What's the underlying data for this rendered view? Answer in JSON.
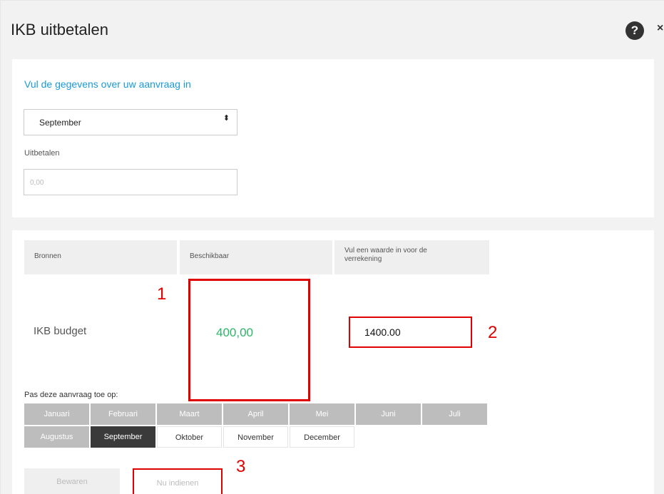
{
  "modal": {
    "title": "IKB uitbetalen",
    "help_icon": "?",
    "close_icon": "×"
  },
  "form": {
    "heading": "Vul de gegevens over uw aanvraag in",
    "month_select": {
      "value": "September",
      "arrows": "⬍"
    },
    "payout_label": "Uitbetalen",
    "payout_placeholder": "0,00"
  },
  "sources_table": {
    "headers": [
      "Bronnen",
      "Beschikbaar",
      "Vul een waarde in voor de verrekening"
    ],
    "row": {
      "label": "IKB budget",
      "available": "400,00",
      "settlement_value": "1400.00"
    }
  },
  "apply": {
    "label": "Pas deze aanvraag toe op:",
    "months": [
      {
        "name": "Januari",
        "state": "disabled"
      },
      {
        "name": "Februari",
        "state": "disabled"
      },
      {
        "name": "Maart",
        "state": "disabled"
      },
      {
        "name": "April",
        "state": "disabled"
      },
      {
        "name": "Mei",
        "state": "disabled"
      },
      {
        "name": "Juni",
        "state": "disabled"
      },
      {
        "name": "Juli",
        "state": "disabled"
      },
      {
        "name": "Augustus",
        "state": "disabled"
      },
      {
        "name": "September",
        "state": "selected"
      },
      {
        "name": "Oktober",
        "state": "available"
      },
      {
        "name": "November",
        "state": "available"
      },
      {
        "name": "December",
        "state": "available"
      }
    ]
  },
  "buttons": {
    "save": "Bewaren",
    "submit": "Nu indienen"
  },
  "annotations": [
    "1",
    "2",
    "3"
  ],
  "colors": {
    "accent": "#1a9ad7",
    "available_green": "#2fb56a",
    "annotation_red": "#e00000",
    "selected_month": "#3a3a3a",
    "disabled_month": "#bdbdbd"
  }
}
